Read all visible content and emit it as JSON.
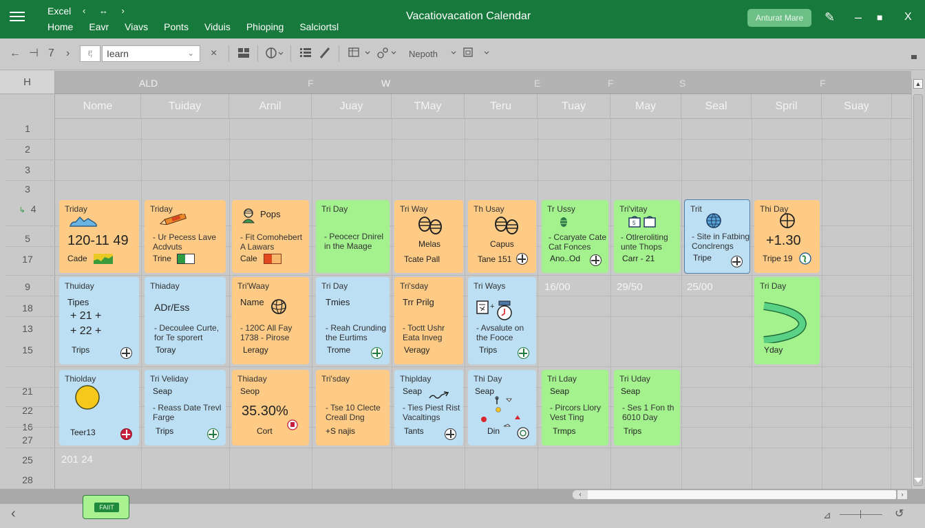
{
  "titlebar": {
    "app_name": "Excel",
    "nav_arrows": "‹ ↔ ›",
    "menu": [
      "Home",
      "Eavr",
      "Viavs",
      "Ponts",
      "Viduis",
      "Phioping",
      "Salciortsl"
    ],
    "doc_title": "Vacatiovacation Calendar",
    "account_button": "Anturat Mare",
    "window_buttons": {
      "pen": "✎",
      "minimize": "–",
      "maximize": "■",
      "close": "X"
    }
  },
  "toolbar": {
    "back": "←",
    "undo": "⊣",
    "redo": "7",
    "forward": "›",
    "cell_ref": "ℓ¦",
    "name_box_value": "Iearn",
    "clear": "×",
    "format_label": "Nepoth"
  },
  "grid": {
    "corner": "H",
    "column_letters": [
      "ALD",
      "F",
      "W",
      "E",
      "F",
      "S",
      "F"
    ],
    "day_headers": [
      "Nome",
      "Tuiday",
      "Arnil",
      "Juay",
      "TMay",
      "Teru",
      "Tuay",
      "May",
      "Seal",
      "Spril",
      "Suay"
    ],
    "row_numbers": [
      "1",
      "2",
      "3",
      "3",
      "4",
      "5",
      "17",
      "9",
      "18",
      "13",
      "15",
      "21",
      "22",
      "16",
      "27",
      "25",
      "28"
    ],
    "free_cells": [
      "16/00",
      "29/50",
      "25/00",
      "201 24"
    ]
  },
  "cards": {
    "row1": [
      {
        "title": "Triday",
        "big": "120-11 49",
        "footer": "Cade",
        "icon": "mountain-icon",
        "color": "orange"
      },
      {
        "title": "Triday",
        "desc": "- Ur Pecess Lave Acdvuts",
        "footer": "Trine",
        "icon": "pencil-icon",
        "color": "orange"
      },
      {
        "title": "Pops",
        "desc": "- Fit Comohebert A Lawars",
        "footer": "Cale",
        "icon": "person-icon",
        "color": "orange"
      },
      {
        "title": "Tri Day",
        "desc": "- Peocecr Dnirel in the Maage",
        "footer": "",
        "color": "green"
      },
      {
        "title": "Tri Way",
        "label": "Melas",
        "footer": "Tcate Pall",
        "icon": "footprints-icon",
        "color": "orange"
      },
      {
        "title": "Th Usay",
        "label": "Capus",
        "footer": "Tane 151",
        "icon": "footprints-icon",
        "color": "orange"
      },
      {
        "title": "Tr Ussy",
        "desc": "- Ccaryate Cate Cat Fonces",
        "footer": "Ano..Od",
        "icon": "pinecone-icon",
        "color": "green"
      },
      {
        "title": "Tri'vitay",
        "desc": "- Otlreroliting unte Thops",
        "footer": "Carr - 21",
        "icon": "bags-icon",
        "color": "green"
      },
      {
        "title": "Trit",
        "desc": "- Site in Fatbing Conclrengs",
        "footer": "Tripe",
        "icon": "globe-icon",
        "color": "blue"
      },
      {
        "title": "Thi Day",
        "big": "+1.30",
        "footer": "Tripe 19",
        "icon": "globe-icon",
        "color": "orange"
      }
    ],
    "row2": [
      {
        "title": "Thuiday",
        "label": "Tipes",
        "lines": [
          "+ 21 +",
          "+ 22 +"
        ],
        "footer": "Trips",
        "color": "blue"
      },
      {
        "title": "Thiaday",
        "label": "ADr/Ess",
        "desc": "- Decoulee Curte, for Te sporert",
        "footer": "Toray",
        "color": "blue"
      },
      {
        "title": "Tri'Waay",
        "label": "Name",
        "desc": "- 120C All Fay 1738 - Pirose",
        "footer": "Leragy",
        "icon": "globe-icon",
        "color": "orange"
      },
      {
        "title": "Tri Day",
        "label": "Tmies",
        "desc": "- Reah Crunding the Eurtims",
        "footer": "Trome",
        "color": "blue"
      },
      {
        "title": "Tri'sday",
        "label": "Trr Prilg",
        "desc": "- Toctt Ushr Eata Inveg",
        "footer": "Veragy",
        "color": "orange"
      },
      {
        "title": "Tri Ways",
        "desc": "- Avsalute on the Fooce",
        "footer": "Trips",
        "icon": "document-clock-icon",
        "color": "blue"
      },
      {
        "title": "Tri Day",
        "footer": "Yday",
        "icon": "arc-icon",
        "color": "green"
      }
    ],
    "row3": [
      {
        "title": "Thiolday",
        "footer": "Teer13",
        "icon": "sun-icon",
        "color": "blue"
      },
      {
        "title": "Tri Veliday",
        "label": "Seap",
        "desc": "- Reass Date Trevl Farge",
        "footer": "Trips",
        "color": "blue"
      },
      {
        "title": "Thiaday",
        "label": "Seop",
        "big": "35.30%",
        "footer": "Cort",
        "color": "orange"
      },
      {
        "title": "Tri'sday",
        "desc": "- Tse 10 Clecte Creall Dng",
        "footer": "+S najis",
        "color": "orange"
      },
      {
        "title": "Thiplday",
        "label": "Seap",
        "desc": "- Ties Piest Rist Vacaltings",
        "footer": "Tants",
        "icon": "trend-arrow-icon",
        "color": "blue"
      },
      {
        "title": "Thi Day",
        "label": "Seap",
        "footer": "Din",
        "icon": "map-pins-icon",
        "color": "blue"
      },
      {
        "title": "Tri Lday",
        "label": "Seap",
        "desc": "- Pircors Llory Vest Ting",
        "footer": "Trmps",
        "color": "green"
      },
      {
        "title": "Tri Uday",
        "label": "Seap",
        "desc": "- Ses 1 Fon th 6010 Day",
        "footer": "Trips",
        "color": "green"
      }
    ]
  },
  "colors": {
    "title_bar": "#177a3c",
    "card_orange": "#fdcb86",
    "card_blue": "#bcdff4",
    "card_green": "#a3f28e"
  },
  "bottom": {
    "sheet_tab": "FAIIT",
    "prev": "‹",
    "scroll_left": "‹",
    "scroll_right": "›",
    "zoom_icon": "⊿",
    "rotate_icon": "↺"
  }
}
